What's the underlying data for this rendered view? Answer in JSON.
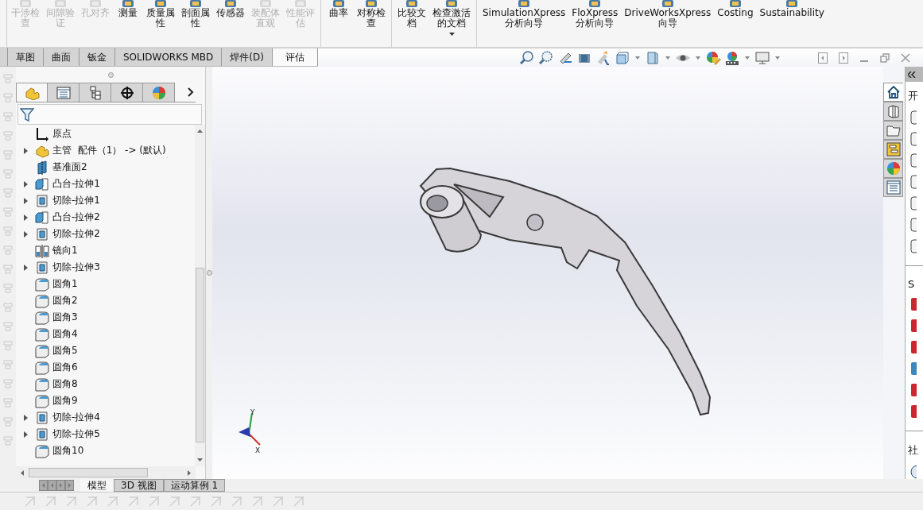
{
  "ribbon": {
    "groups": [
      [
        {
          "lines": [
            "干涉检",
            "查"
          ],
          "disabled": true,
          "dropdown": false
        },
        {
          "lines": [
            "间隙验",
            "证"
          ],
          "disabled": true,
          "dropdown": false
        },
        {
          "lines": [
            "孔对齐"
          ],
          "disabled": true,
          "dropdown": false
        },
        {
          "lines": [
            "测量"
          ],
          "disabled": false,
          "dropdown": false
        },
        {
          "lines": [
            "质量属",
            "性"
          ],
          "disabled": false,
          "dropdown": false
        },
        {
          "lines": [
            "剖面属",
            "性"
          ],
          "disabled": false,
          "dropdown": false
        },
        {
          "lines": [
            "传感器"
          ],
          "disabled": false,
          "dropdown": false
        },
        {
          "lines": [
            "装配体",
            "直观"
          ],
          "disabled": true,
          "dropdown": false
        },
        {
          "lines": [
            "性能评",
            "估"
          ],
          "disabled": true,
          "dropdown": false
        }
      ],
      [
        {
          "lines": [
            "曲率"
          ],
          "disabled": false,
          "dropdown": false
        },
        {
          "lines": [
            "对称检",
            "查"
          ],
          "disabled": false,
          "dropdown": false
        }
      ],
      [
        {
          "lines": [
            "比较文",
            "档"
          ],
          "disabled": false,
          "dropdown": false
        },
        {
          "lines": [
            "检查激活",
            "的文档"
          ],
          "disabled": false,
          "dropdown": true
        }
      ],
      [
        {
          "lines": [
            "SimulationXpress",
            "分析向导"
          ],
          "disabled": false,
          "dropdown": false
        },
        {
          "lines": [
            "FloXpress",
            "分析向导"
          ],
          "disabled": false,
          "dropdown": false
        },
        {
          "lines": [
            "DriveWorksXpress",
            "向导"
          ],
          "disabled": false,
          "dropdown": false
        },
        {
          "lines": [
            "Costing"
          ],
          "disabled": false,
          "dropdown": false
        },
        {
          "lines": [
            "Sustainability"
          ],
          "disabled": false,
          "dropdown": false
        }
      ]
    ]
  },
  "command_tabs": [
    {
      "label": "草图",
      "selected": false
    },
    {
      "label": "曲面",
      "selected": false
    },
    {
      "label": "钣金",
      "selected": false
    },
    {
      "label": "SOLIDWORKS MBD",
      "selected": false
    },
    {
      "label": "焊件(D)",
      "selected": false
    },
    {
      "label": "评估",
      "selected": true
    }
  ],
  "feature_tree": {
    "panel_tabs": [
      {
        "selected": true
      },
      {
        "selected": false
      },
      {
        "selected": false
      },
      {
        "selected": false
      },
      {
        "selected": false
      }
    ],
    "items": [
      {
        "label": "原点",
        "kind": "origin",
        "expandable": false
      },
      {
        "label": "主管  配件（1） -> (默认)",
        "kind": "part",
        "expandable": true
      },
      {
        "label": "基准面2",
        "kind": "plane",
        "expandable": false
      },
      {
        "label": "凸台-拉伸1",
        "kind": "boss",
        "expandable": true
      },
      {
        "label": "切除-拉伸1",
        "kind": "cut",
        "expandable": true
      },
      {
        "label": "凸台-拉伸2",
        "kind": "boss",
        "expandable": true
      },
      {
        "label": "切除-拉伸2",
        "kind": "cut",
        "expandable": true
      },
      {
        "label": "镜向1",
        "kind": "mirror",
        "expandable": false
      },
      {
        "label": "切除-拉伸3",
        "kind": "cut",
        "expandable": true
      },
      {
        "label": "圆角1",
        "kind": "fillet",
        "expandable": false
      },
      {
        "label": "圆角2",
        "kind": "fillet",
        "expandable": false
      },
      {
        "label": "圆角3",
        "kind": "fillet",
        "expandable": false
      },
      {
        "label": "圆角4",
        "kind": "fillet",
        "expandable": false
      },
      {
        "label": "圆角5",
        "kind": "fillet",
        "expandable": false
      },
      {
        "label": "圆角6",
        "kind": "fillet",
        "expandable": false
      },
      {
        "label": "圆角8",
        "kind": "fillet",
        "expandable": false
      },
      {
        "label": "圆角9",
        "kind": "fillet",
        "expandable": false
      },
      {
        "label": "切除-拉伸4",
        "kind": "cut",
        "expandable": true
      },
      {
        "label": "切除-拉伸5",
        "kind": "cut",
        "expandable": true
      },
      {
        "label": "圆角10",
        "kind": "fillet",
        "expandable": false
      }
    ]
  },
  "bottom_tabs": [
    {
      "label": "模型",
      "selected": true
    },
    {
      "label": "3D 视图",
      "selected": false
    },
    {
      "label": "运动算例 1",
      "selected": false
    }
  ],
  "viewport": {
    "triad_labels": [
      "Y",
      "X"
    ]
  },
  "task_pane": {
    "tabs": [
      {
        "selected": true
      },
      {
        "selected": false
      },
      {
        "selected": false
      },
      {
        "selected": false
      },
      {
        "selected": false
      },
      {
        "selected": false
      }
    ],
    "section_titles": [
      "开",
      "S",
      "社"
    ]
  }
}
